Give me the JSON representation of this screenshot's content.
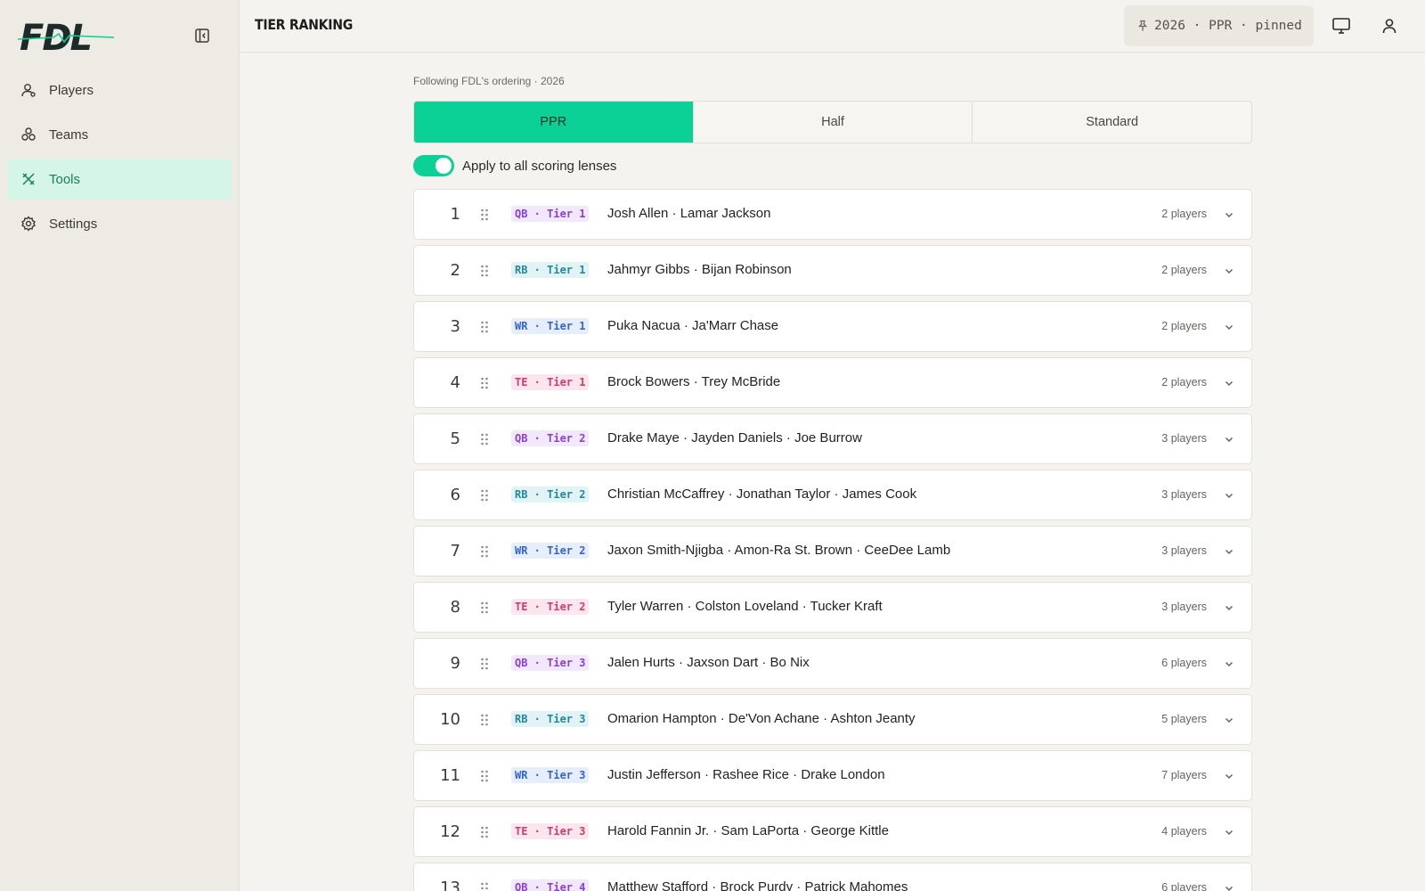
{
  "app": {
    "brand": "FDL",
    "brand_color": "#0bd197"
  },
  "sidebar": {
    "items": [
      {
        "label": "Players",
        "icon": "user-icon",
        "active": false
      },
      {
        "label": "Teams",
        "icon": "teams-icon",
        "active": false
      },
      {
        "label": "Tools",
        "icon": "tools-icon",
        "active": true
      },
      {
        "label": "Settings",
        "icon": "gear-icon",
        "active": false
      }
    ]
  },
  "header": {
    "title": "TIER RANKING",
    "pin_chip": "2026 · PPR · pinned"
  },
  "main": {
    "caption": "Following FDL's ordering · 2026",
    "scoring_tabs": [
      {
        "label": "PPR",
        "active": true
      },
      {
        "label": "Half",
        "active": false
      },
      {
        "label": "Standard",
        "active": false
      }
    ],
    "apply_all": {
      "label": "Apply to all scoring lenses",
      "on": true
    },
    "tiers": [
      {
        "rank": "1",
        "tag": "QB · Tier 1",
        "pos": "qb",
        "names": "Josh Allen · Lamar Jackson",
        "count": "2 players"
      },
      {
        "rank": "2",
        "tag": "RB · Tier 1",
        "pos": "rb",
        "names": "Jahmyr Gibbs · Bijan Robinson",
        "count": "2 players"
      },
      {
        "rank": "3",
        "tag": "WR · Tier 1",
        "pos": "wr",
        "names": "Puka Nacua · Ja'Marr Chase",
        "count": "2 players"
      },
      {
        "rank": "4",
        "tag": "TE · Tier 1",
        "pos": "te",
        "names": "Brock Bowers · Trey McBride",
        "count": "2 players"
      },
      {
        "rank": "5",
        "tag": "QB · Tier 2",
        "pos": "qb",
        "names": "Drake Maye · Jayden Daniels · Joe Burrow",
        "count": "3 players"
      },
      {
        "rank": "6",
        "tag": "RB · Tier 2",
        "pos": "rb",
        "names": "Christian McCaffrey · Jonathan Taylor · James Cook",
        "count": "3 players"
      },
      {
        "rank": "7",
        "tag": "WR · Tier 2",
        "pos": "wr",
        "names": "Jaxon Smith-Njigba · Amon-Ra St. Brown · CeeDee Lamb",
        "count": "3 players"
      },
      {
        "rank": "8",
        "tag": "TE · Tier 2",
        "pos": "te",
        "names": "Tyler Warren · Colston Loveland · Tucker Kraft",
        "count": "3 players"
      },
      {
        "rank": "9",
        "tag": "QB · Tier 3",
        "pos": "qb",
        "names": "Jalen Hurts · Jaxson Dart · Bo Nix",
        "count": "6 players"
      },
      {
        "rank": "10",
        "tag": "RB · Tier 3",
        "pos": "rb",
        "names": "Omarion Hampton · De'Von Achane · Ashton Jeanty",
        "count": "5 players"
      },
      {
        "rank": "11",
        "tag": "WR · Tier 3",
        "pos": "wr",
        "names": "Justin Jefferson · Rashee Rice · Drake London",
        "count": "7 players"
      },
      {
        "rank": "12",
        "tag": "TE · Tier 3",
        "pos": "te",
        "names": "Harold Fannin Jr. · Sam LaPorta · George Kittle",
        "count": "4 players"
      },
      {
        "rank": "13",
        "tag": "QB · Tier 4",
        "pos": "qb",
        "names": "Matthew Stafford · Brock Purdy · Patrick Mahomes",
        "count": "6 players"
      }
    ]
  }
}
